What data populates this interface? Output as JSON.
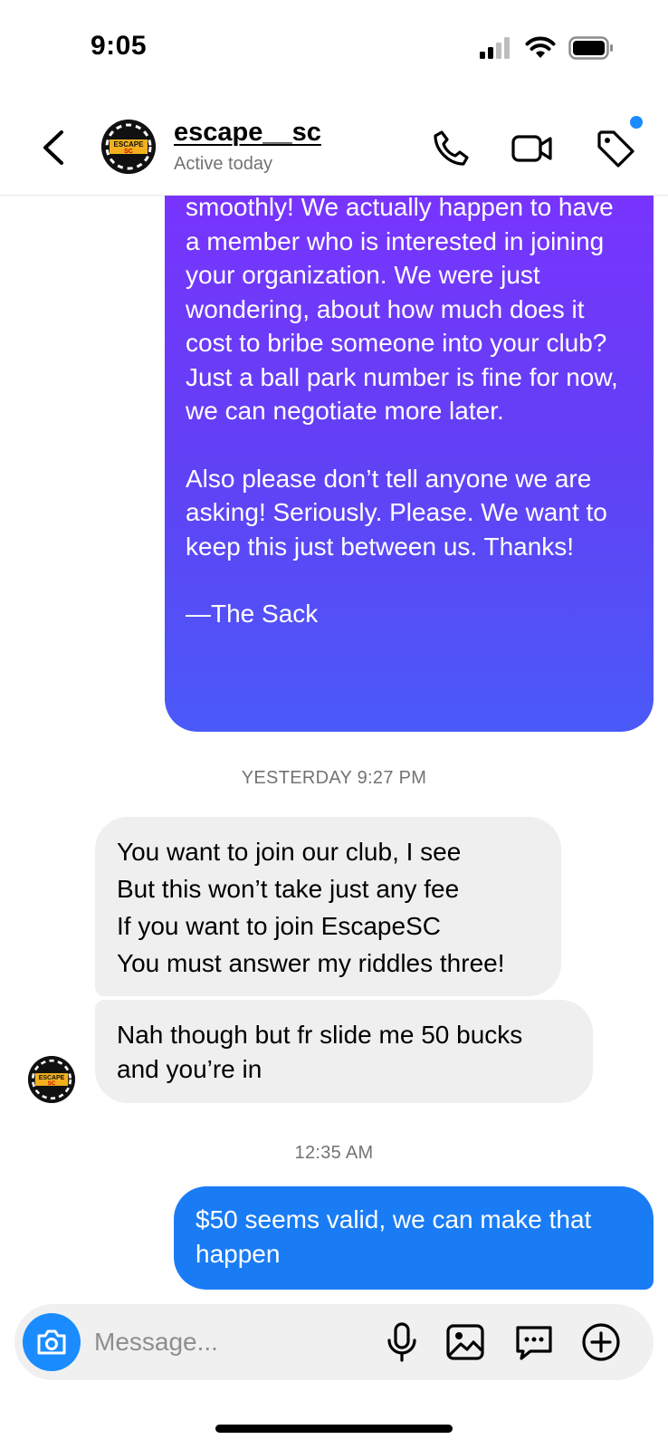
{
  "status_bar": {
    "time": "9:05"
  },
  "header": {
    "username": "escape__sc",
    "status": "Active today",
    "avatar_text": "ESCAPE SC"
  },
  "messages": {
    "outgoing_long": {
      "paragraphs": [
        "smoothly! We actually happen to have a member who is interested in joining your organization. We were just wondering, about how much does it cost to bribe someone into your club? Just a ball park number is fine for now, we can negotiate more later.",
        "Also please don’t tell anyone we are asking! Seriously. Please. We want to keep this just between us. Thanks!",
        "—The Sack"
      ]
    },
    "timestamp_1": "YESTERDAY 9:27 PM",
    "incoming_1_lines": [
      "You want to join our club, I see",
      "But this won’t take just any fee",
      "If you want to join EscapeSC",
      "You must answer my riddles three!"
    ],
    "incoming_2": "Nah though but fr slide me 50 bucks and you’re in",
    "timestamp_2": "12:35 AM",
    "outgoing_short": "$50 seems valid, we can make that happen"
  },
  "composer": {
    "placeholder": "Message..."
  },
  "colors": {
    "gradient_top": "#7a33ff",
    "gradient_bottom": "#4a5af8",
    "outgoing_blue": "#1a7cf5",
    "incoming_gray": "#efefef",
    "accent": "#1a8cff"
  }
}
